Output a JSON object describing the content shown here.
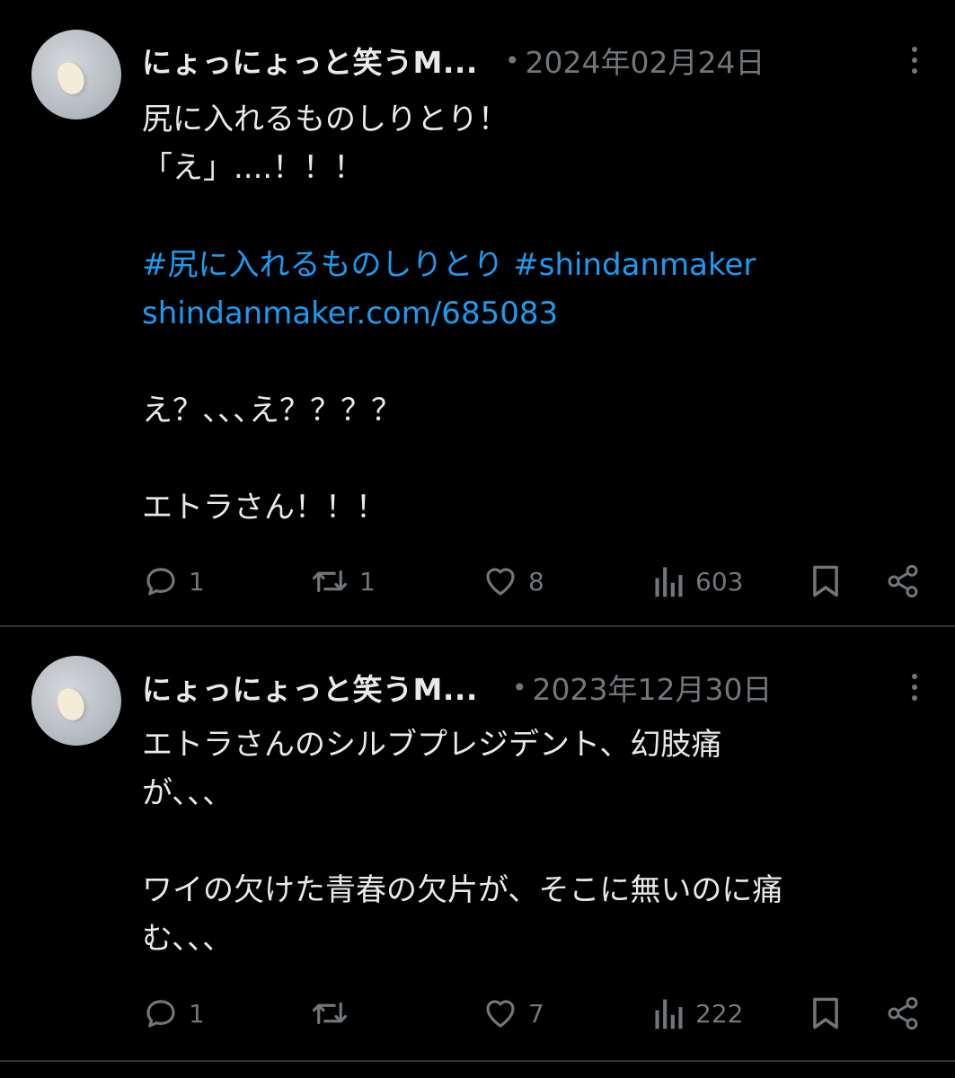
{
  "posts": [
    {
      "author": "にょっにょっと笑うM...",
      "separator": "•",
      "date": "2024年02月24日",
      "lines": [
        {
          "text": "尻に入れるものしりとり！",
          "type": "text"
        },
        {
          "text": "「え」....！！！",
          "type": "text"
        },
        {
          "text": "",
          "type": "blank"
        },
        {
          "text": "#尻に入れるものしりとり #shindanmaker",
          "type": "link"
        },
        {
          "text": "shindanmaker.com/685083",
          "type": "link"
        },
        {
          "text": "",
          "type": "blank"
        },
        {
          "text": "え？､､､え？？？？",
          "type": "text"
        },
        {
          "text": "",
          "type": "blank"
        },
        {
          "text": "エトラさん！！！",
          "type": "text"
        }
      ],
      "actions": {
        "reply": "1",
        "repost": "1",
        "like": "8",
        "views": "603"
      }
    },
    {
      "author": "にょっにょっと笑うM...",
      "separator": "•",
      "date": "2023年12月30日",
      "lines": [
        {
          "text": "エトラさんのシルブプレジデント、幻肢痛",
          "type": "text"
        },
        {
          "text": "が､､､",
          "type": "text"
        },
        {
          "text": "",
          "type": "blank"
        },
        {
          "text": "ワイの欠けた青春の欠片が、そこに無いのに痛",
          "type": "text"
        },
        {
          "text": "む､､､",
          "type": "text"
        }
      ],
      "actions": {
        "reply": "1",
        "repost": "",
        "like": "7",
        "views": "222"
      }
    }
  ],
  "icons": {
    "reply": "speech-bubble-icon",
    "repost": "repost-arrows-icon",
    "like": "heart-icon",
    "views": "bar-chart-icon",
    "bookmark": "bookmark-icon",
    "share": "share-icon",
    "more": "more-dots-icon"
  },
  "colors": {
    "background": "#000000",
    "text": "#e7e9ea",
    "muted": "#71767b",
    "link": "#1d9bf0",
    "divider": "#2f3336"
  }
}
